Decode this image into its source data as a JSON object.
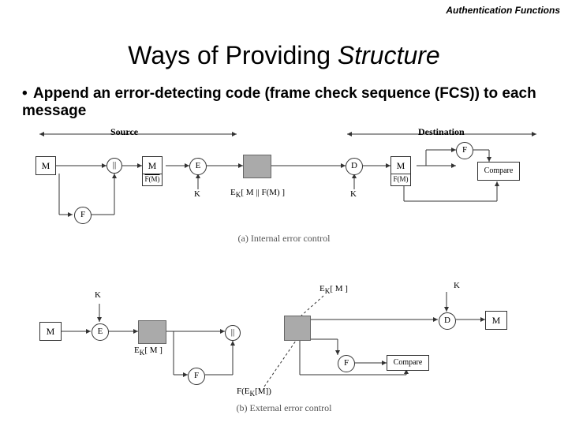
{
  "header": "Authentication Functions",
  "title_plain": "Ways of Providing ",
  "title_italic": "Structure",
  "bullet": "Append an error-detecting code (frame check sequence (FCS)) to each message",
  "section_a": {
    "source": "Source",
    "destination": "Destination",
    "M": "M",
    "concat": "||",
    "E": "E",
    "D": "D",
    "F": "F",
    "FofM": "F(M)",
    "K": "K",
    "Ek": "E",
    "Ek_sub": "K",
    "Ek_arg": "[ M || F(M) ]",
    "compare": "Compare",
    "caption": "(a) Internal error control"
  },
  "section_b": {
    "M": "M",
    "E": "E",
    "K": "K",
    "D": "D",
    "F": "F",
    "concat": "||",
    "Ek_M": "E",
    "Ek_M_sub": "K",
    "Ek_M_arg": "[ M ]",
    "F_arg": "F(E",
    "F_arg_sub": "K",
    "F_arg_rest": "[M])",
    "compare": "Compare",
    "caption": "(b) External error control"
  }
}
